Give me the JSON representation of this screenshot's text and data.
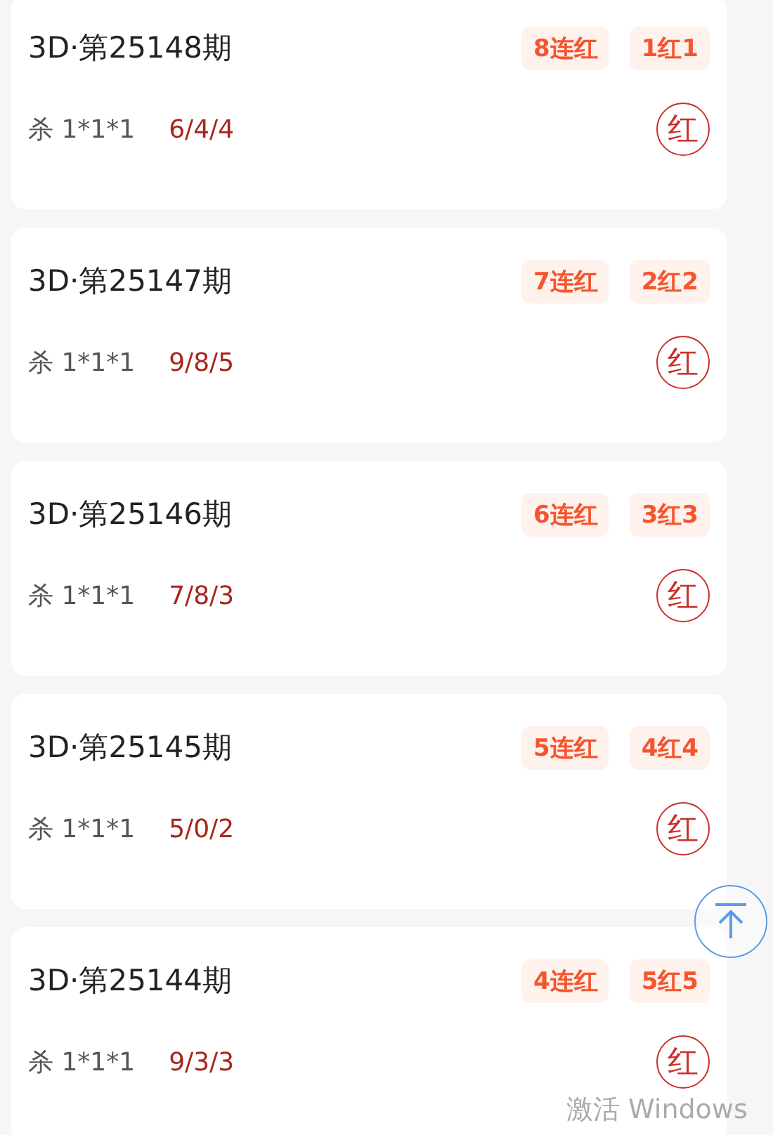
{
  "records": [
    {
      "title": "3D·第25148期",
      "tags": [
        "8连红",
        "1红1"
      ],
      "kill": "杀 1*1*1",
      "numbers": "6/4/4",
      "result": "红"
    },
    {
      "title": "3D·第25147期",
      "tags": [
        "7连红",
        "2红2"
      ],
      "kill": "杀 1*1*1",
      "numbers": "9/8/5",
      "result": "红"
    },
    {
      "title": "3D·第25146期",
      "tags": [
        "6连红",
        "3红3"
      ],
      "kill": "杀 1*1*1",
      "numbers": "7/8/3",
      "result": "红"
    },
    {
      "title": "3D·第25145期",
      "tags": [
        "5连红",
        "4红4"
      ],
      "kill": "杀 1*1*1",
      "numbers": "5/0/2",
      "result": "红"
    },
    {
      "title": "3D·第25144期",
      "tags": [
        "4连红",
        "5红5"
      ],
      "kill": "杀 1*1*1",
      "numbers": "9/3/3",
      "result": "红"
    }
  ],
  "os_notice": "激活 Windows"
}
